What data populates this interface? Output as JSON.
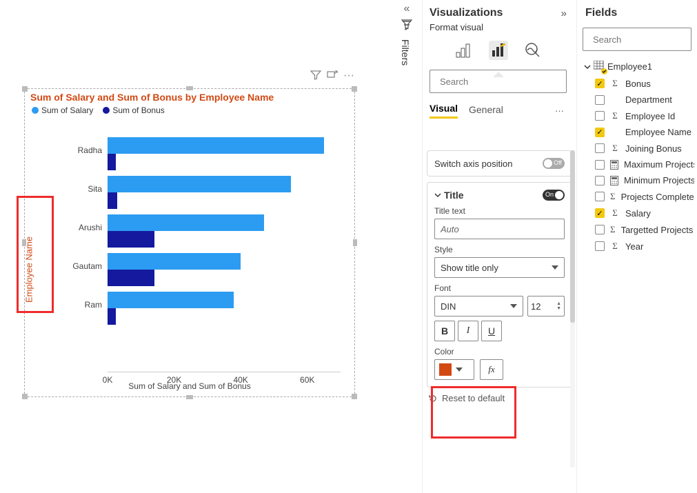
{
  "chart": {
    "title": "Sum of Salary and Sum of Bonus by Employee Name",
    "legend": {
      "series1": "Sum of Salary",
      "series2": "Sum of Bonus"
    },
    "yaxis_title": "Employee Name",
    "xaxis_title": "Sum of Salary and Sum of Bonus",
    "xticks": [
      "0K",
      "20K",
      "40K",
      "60K"
    ]
  },
  "chart_data": {
    "type": "bar",
    "orientation": "horizontal",
    "categories": [
      "Radha",
      "Sita",
      "Arushi",
      "Gautam",
      "Ram"
    ],
    "series": [
      {
        "name": "Sum of Salary",
        "color": "#2c9cf2",
        "values": [
          65000,
          55000,
          47000,
          40000,
          38000
        ]
      },
      {
        "name": "Sum of Bonus",
        "color": "#14199e",
        "values": [
          2500,
          3000,
          14000,
          14000,
          2500
        ]
      }
    ],
    "xlabel": "Sum of Salary and Sum of Bonus",
    "ylabel": "Employee Name",
    "xlim": [
      0,
      70000
    ]
  },
  "filters_label": "Filters",
  "viz": {
    "header": "Visualizations",
    "format_visual": "Format visual",
    "search_placeholder": "Search",
    "tab_visual": "Visual",
    "tab_general": "General",
    "switch_axis": "Switch axis position",
    "switch_axis_state": "Off",
    "title_section": "Title",
    "title_state": "On",
    "title_text_label": "Title text",
    "title_text_value": "Auto",
    "style_label": "Style",
    "style_value": "Show title only",
    "font_label": "Font",
    "font_name": "DIN",
    "font_size": "12",
    "color_label": "Color",
    "fx": "fx",
    "reset": "Reset to default"
  },
  "fields": {
    "header": "Fields",
    "search_placeholder": "Search",
    "table": "Employee1",
    "items": [
      {
        "label": "Bonus",
        "checked": true,
        "icon": "sigma"
      },
      {
        "label": "Department",
        "checked": false,
        "icon": ""
      },
      {
        "label": "Employee Id",
        "checked": false,
        "icon": "sigma"
      },
      {
        "label": "Employee Name",
        "checked": true,
        "icon": ""
      },
      {
        "label": "Joining Bonus",
        "checked": false,
        "icon": "sigma"
      },
      {
        "label": "Maximum Projects",
        "checked": false,
        "icon": "calc"
      },
      {
        "label": "Minimum Projects",
        "checked": false,
        "icon": "calc"
      },
      {
        "label": "Projects Completed",
        "checked": false,
        "icon": "sigma"
      },
      {
        "label": "Salary",
        "checked": true,
        "icon": "sigma"
      },
      {
        "label": "Targetted Projects",
        "checked": false,
        "icon": "sigma"
      },
      {
        "label": "Year",
        "checked": false,
        "icon": "sigma"
      }
    ]
  }
}
